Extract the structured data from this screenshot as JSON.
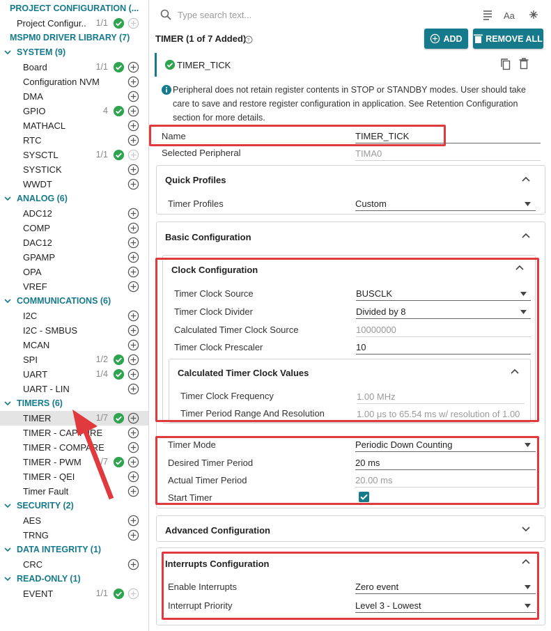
{
  "tree": {
    "project_config": "PROJECT CONFIGURATION (...",
    "project_config_item": "Project Configur...",
    "project_config_count": "1/1",
    "driver_lib": "MSPM0 DRIVER LIBRARY (7)",
    "system": "SYSTEM (9)",
    "board": "Board",
    "board_count": "1/1",
    "config_nvm": "Configuration NVM",
    "dma": "DMA",
    "gpio": "GPIO",
    "gpio_count": "4",
    "mathacl": "MATHACL",
    "rtc": "RTC",
    "sysctl": "SYSCTL",
    "sysctl_count": "1/1",
    "systick": "SYSTICK",
    "wwdt": "WWDT",
    "analog": "ANALOG (6)",
    "adc12": "ADC12",
    "comp": "COMP",
    "dac12": "DAC12",
    "gpamp": "GPAMP",
    "opa": "OPA",
    "vref": "VREF",
    "communications": "COMMUNICATIONS (6)",
    "i2c": "I2C",
    "i2c_smbus": "I2C - SMBUS",
    "mcan": "MCAN",
    "spi": "SPI",
    "spi_count": "1/2",
    "uart": "UART",
    "uart_count": "1/4",
    "uart_lin": "UART - LIN",
    "timers": "TIMERS (6)",
    "timer": "TIMER",
    "timer_count": "1/7",
    "timer_capture": "TIMER - CAPTURE",
    "timer_compare": "TIMER - COMPARE",
    "timer_pwm": "TIMER - PWM",
    "timer_pwm_count": "1/7",
    "timer_qei": "TIMER - QEI",
    "timer_fault": "Timer Fault",
    "security": "SECURITY (2)",
    "aes": "AES",
    "trng": "TRNG",
    "data_integrity": "DATA INTEGRITY (1)",
    "crc": "CRC",
    "read_only": "READ-ONLY (1)",
    "event": "EVENT",
    "event_count": "1/1"
  },
  "search": {
    "placeholder": "Type search text..."
  },
  "header": {
    "title": "TIMER (1 of 7 Added)",
    "add_label": "ADD",
    "remove_label": "REMOVE ALL"
  },
  "instance": {
    "name": "TIMER_TICK"
  },
  "info": "Peripheral does not retain register contents in STOP or STANDBY modes. User should take care to save and restore register configuration in application. See Retention Configuration section for more details.",
  "fields": {
    "name_label": "Name",
    "name_value": "TIMER_TICK",
    "peripheral_label": "Selected Peripheral",
    "peripheral_value": "TIMA0"
  },
  "quick_profiles": {
    "title": "Quick Profiles",
    "label": "Timer Profiles",
    "value": "Custom"
  },
  "basic": {
    "title": "Basic Configuration"
  },
  "clock": {
    "title": "Clock Configuration",
    "source_label": "Timer Clock Source",
    "source_value": "BUSCLK",
    "divider_label": "Timer Clock Divider",
    "divider_value": "Divided by 8",
    "calc_label": "Calculated Timer Clock Source",
    "calc_value": "10000000",
    "prescaler_label": "Timer Clock Prescaler",
    "prescaler_value": "10",
    "calc_values_title": "Calculated Timer Clock Values",
    "freq_label": "Timer Clock Frequency",
    "freq_value": "1.00 MHz",
    "range_label": "Timer Period Range And Resolution",
    "range_value": "1.00 μs to 65.54 ms w/ resolution of 1.00"
  },
  "timer_settings": {
    "mode_label": "Timer Mode",
    "mode_value": "Periodic Down Counting",
    "desired_label": "Desired Timer Period",
    "desired_value": "20 ms",
    "actual_label": "Actual Timer Period",
    "actual_value": "20.00 ms",
    "start_label": "Start Timer",
    "start_checked": true
  },
  "advanced": {
    "title": "Advanced Configuration"
  },
  "interrupts": {
    "title": "Interrupts Configuration",
    "enable_label": "Enable Interrupts",
    "enable_value": "Zero event",
    "priority_label": "Interrupt Priority",
    "priority_value": "Level 3 - Lowest"
  },
  "colors": {
    "accent": "#157a8c",
    "check": "#2ea44f",
    "highlight": "#e03a3e"
  }
}
